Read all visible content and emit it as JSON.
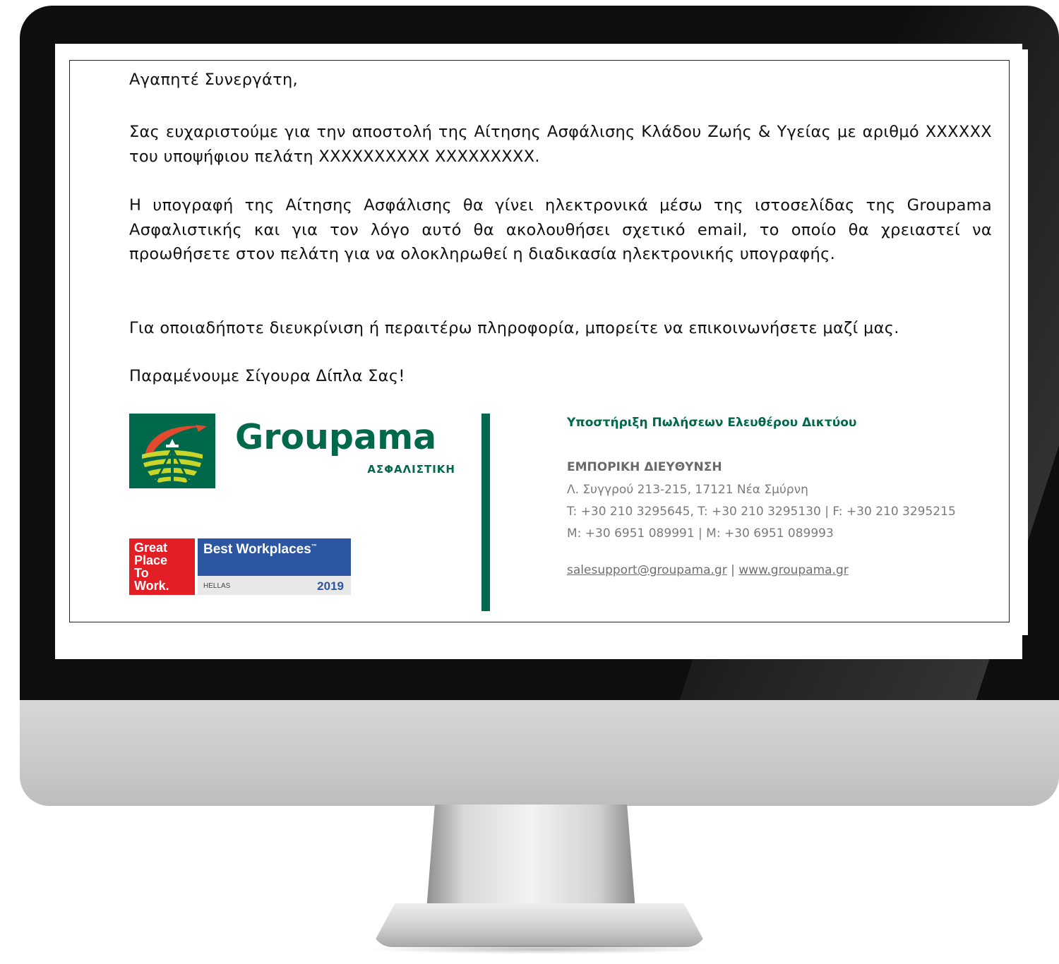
{
  "email": {
    "salutation": "Αγαπητέ Συνεργάτη,",
    "paragraph_1": "Σας ευχαριστούμε για την αποστολή της Αίτησης Ασφάλισης Κλάδου Ζωής & Υγείας με αριθμό XXXXXX του υποψήφιου πελάτη XXXXXXXXXX XXXXXXXXX.",
    "paragraph_2": "Η υπογραφή της Αίτησης Ασφάλισης θα γίνει ηλεκτρονικά μέσω της ιστοσελίδας της Groupama Ασφαλιστικής και για τον λόγο αυτό θα ακολουθήσει σχετικό email, το οποίο θα χρειαστεί να προωθήσετε στον πελάτη για να ολοκληρωθεί η διαδικασία ηλεκτρονικής υπογραφής.",
    "paragraph_3": "Για οποιαδήποτε διευκρίνιση ή περαιτέρω πληροφορία, μπορείτε να επικοινωνήσετε μαζί μας.",
    "closing": "Παραμένουμε Σίγουρα Δίπλα Σας!"
  },
  "logo": {
    "wordmark": "Groupama",
    "subtitle": "ΑΣΦΑΛΙΣΤΙΚΗ",
    "brand_color": "#00694b"
  },
  "badge": {
    "gptw_lines": [
      "Great",
      "Place",
      "To",
      "Work."
    ],
    "title": "Best Workplaces",
    "trademark": "™",
    "country": "HELLAS",
    "year": "2019"
  },
  "signature": {
    "department": "Υποστήριξη Πωλήσεων Ελευθέρου Δικτύου",
    "company": "ΕΜΠΟΡΙΚΗ ΔΙΕΥΘΥΝΣΗ",
    "address": "Λ. Συγγρού 213-215, 17121 Νέα Σμύρνη",
    "phones": "T: +30 210 3295645, T: +30 210 3295130 | F: +30 210 3295215",
    "mobiles": "M: +30 6951 089991 | M: +30 6951 089993",
    "email_link": "salesupport@groupama.gr",
    "separator": " | ",
    "web_link": "www.groupama.gr"
  }
}
